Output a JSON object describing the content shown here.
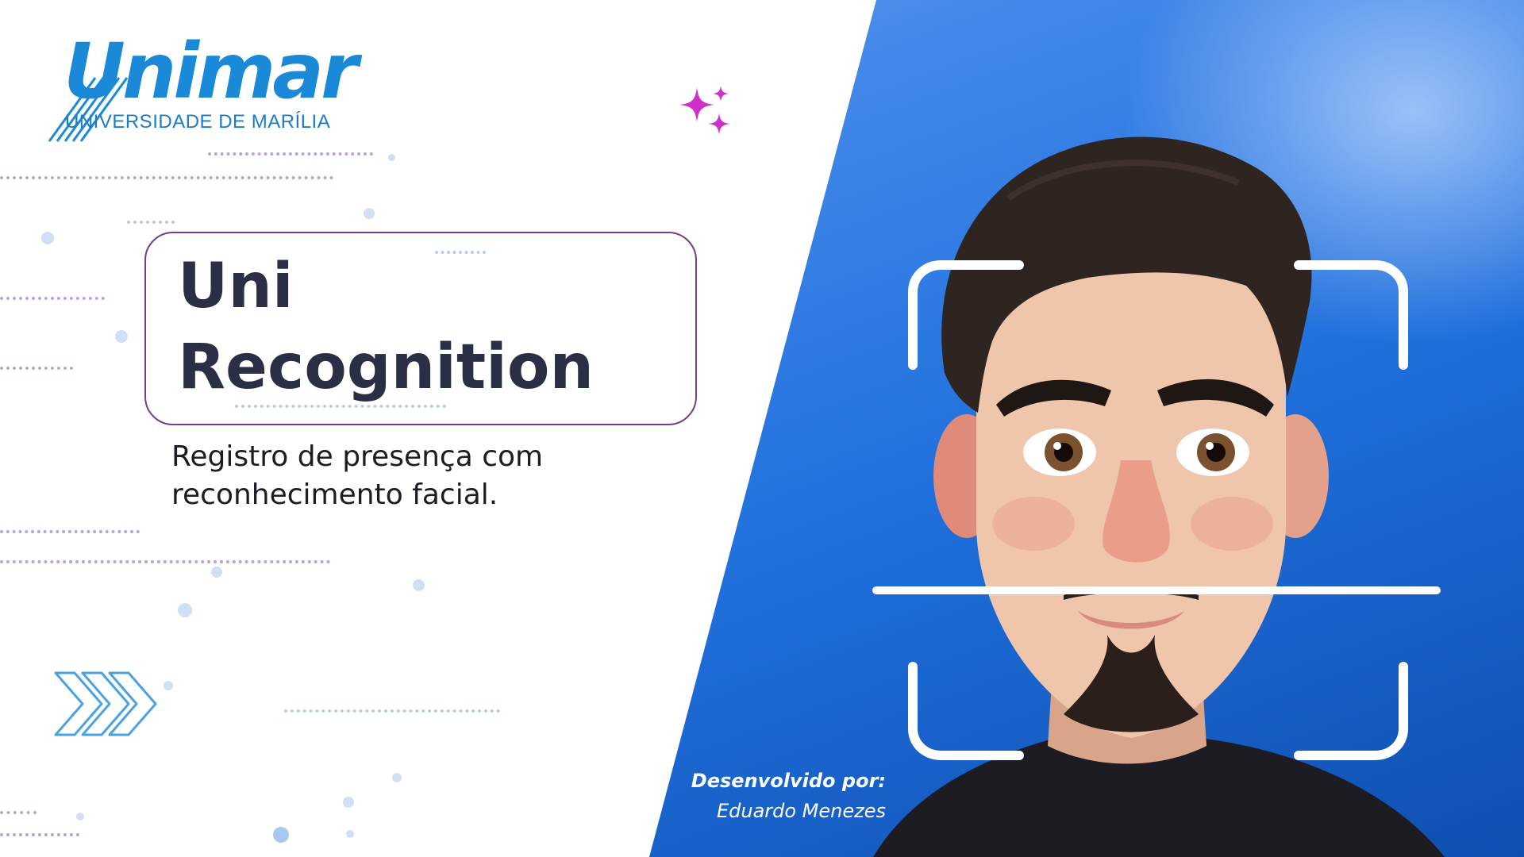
{
  "logo": {
    "wordmark": "Unimar",
    "subtitle": "UNIVERSIDADE DE MARÍLIA",
    "color": "#1a8ad8"
  },
  "title": {
    "line1": "Uni",
    "line2": "Recognition"
  },
  "subtitle": "Registro de presença com reconhecimento facial.",
  "credits": {
    "label": "Desenvolvido por:",
    "name": "Eduardo Menezes"
  },
  "icons": {
    "sparkle": "sparkle-icon",
    "chevrons": "chevrons-right-icon",
    "face_scan": "face-scan-frame-icon"
  },
  "colors": {
    "accent_purple": "#7a3a8a",
    "sparkle": "#d12fc9",
    "panel_blue": "#1f6fdc",
    "title_text": "#2b2f45"
  }
}
